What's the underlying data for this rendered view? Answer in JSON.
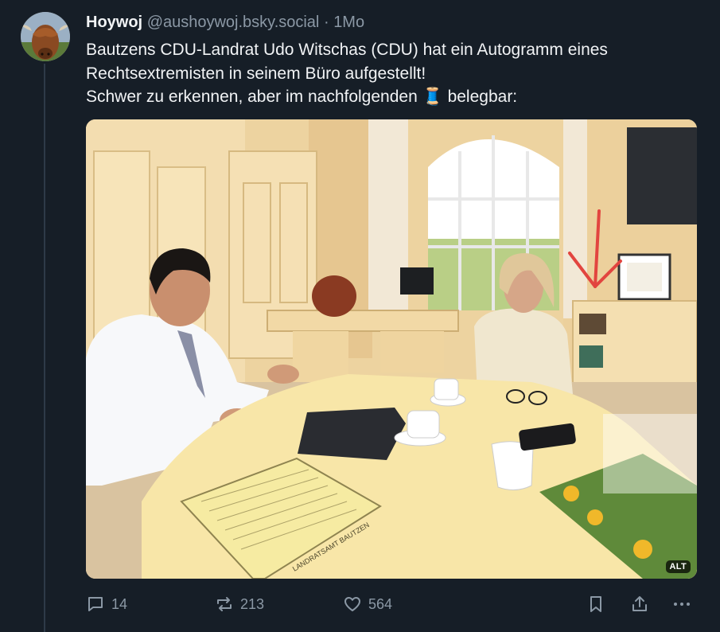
{
  "post": {
    "author_name": "Hoywoj",
    "author_handle": "@aushoywoj.bsky.social",
    "separator": "·",
    "time": "1Mo",
    "text_lines": [
      "Bautzens CDU-Landrat Udo Witschas (CDU) hat ein Autogramm eines",
      "Rechtsextremisten in seinem Büro aufgestellt!",
      "Schwer zu erkennen, aber im nachfolgenden 🧵 belegbar:"
    ],
    "image": {
      "alt_badge": "ALT",
      "folder_label": "LANDRATSAMT BAUTZEN"
    }
  },
  "actions": {
    "replies": "14",
    "reposts": "213",
    "likes": "564"
  },
  "colors": {
    "background": "#161e27",
    "text": "#f1f3f5",
    "muted": "#8b98a5",
    "thread_line": "#2e3a48"
  }
}
